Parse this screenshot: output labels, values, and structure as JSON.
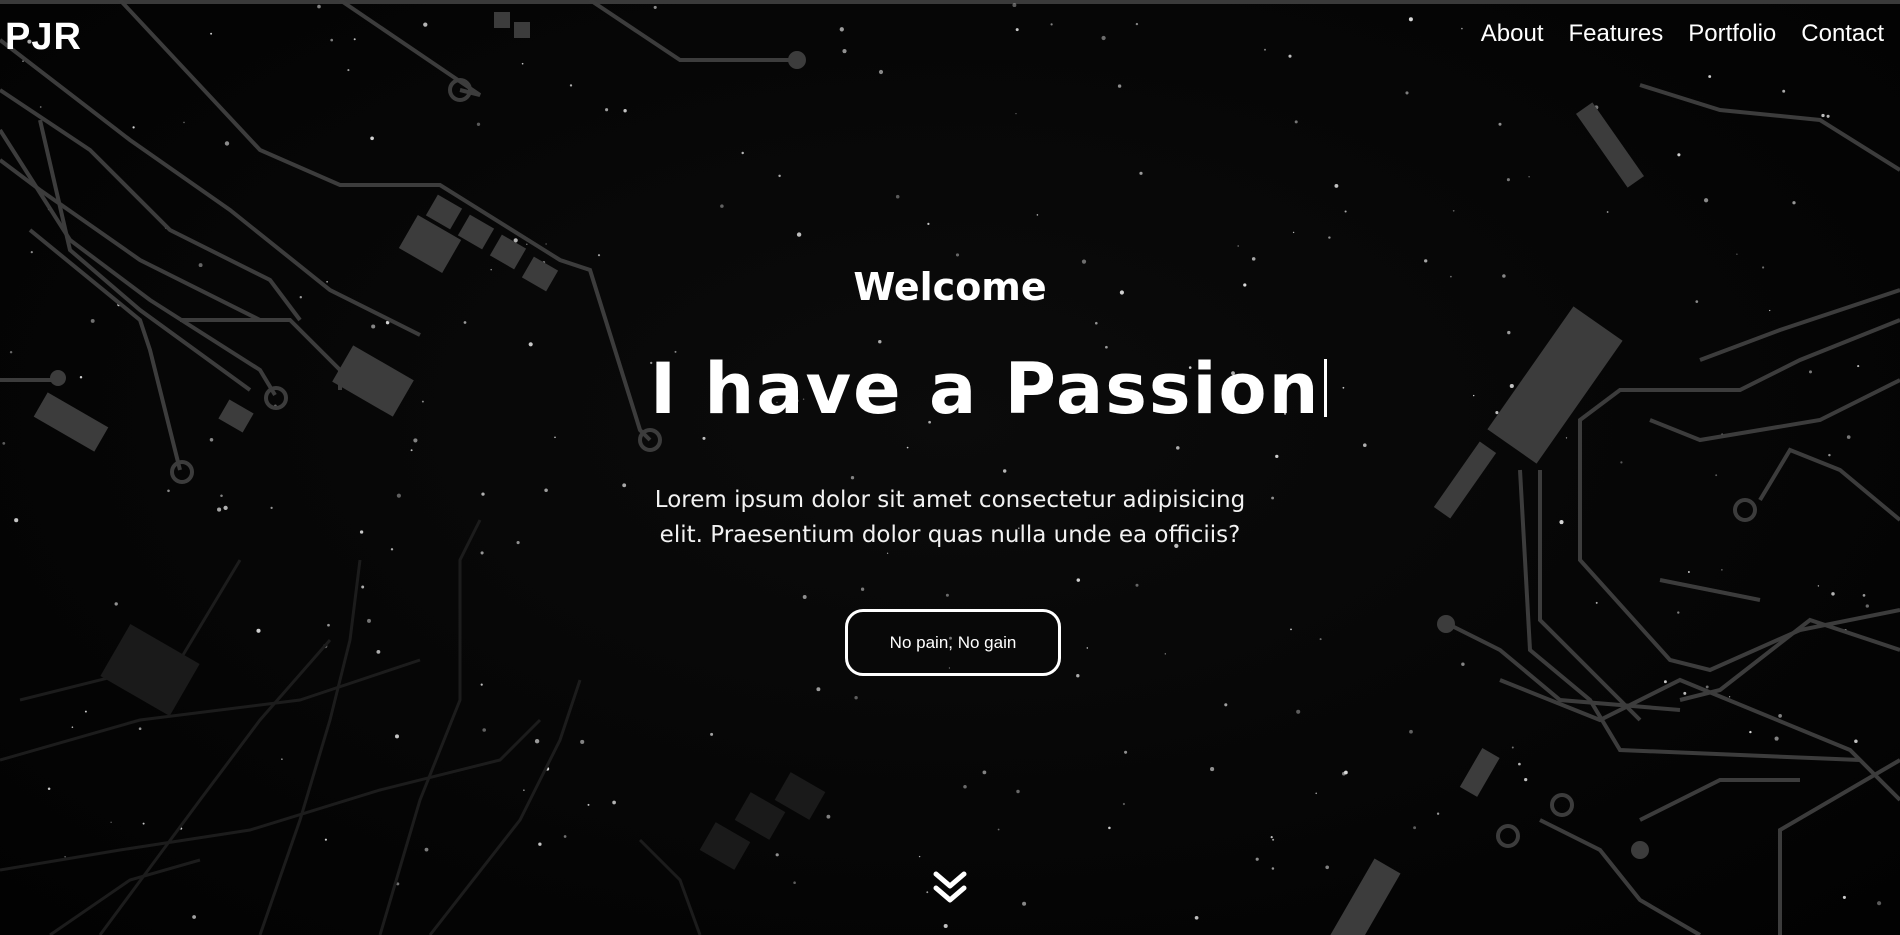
{
  "nav": {
    "brand": "PJR",
    "links": [
      {
        "label": "About"
      },
      {
        "label": "Features"
      },
      {
        "label": "Portfolio"
      },
      {
        "label": "Contact"
      }
    ]
  },
  "hero": {
    "welcome": "Welcome",
    "headline": "I have a Passion",
    "description": "Lorem ipsum dolor sit amet consectetur adipisicing elit. Praesentium dolor quas nulla unde ea officiis?",
    "cta_label": "No pain, No gain",
    "scroll_icon": "double-chevron-down-icon"
  },
  "colors": {
    "background": "#050505",
    "text": "#ffffff",
    "circuit": "#3a3a3a"
  }
}
